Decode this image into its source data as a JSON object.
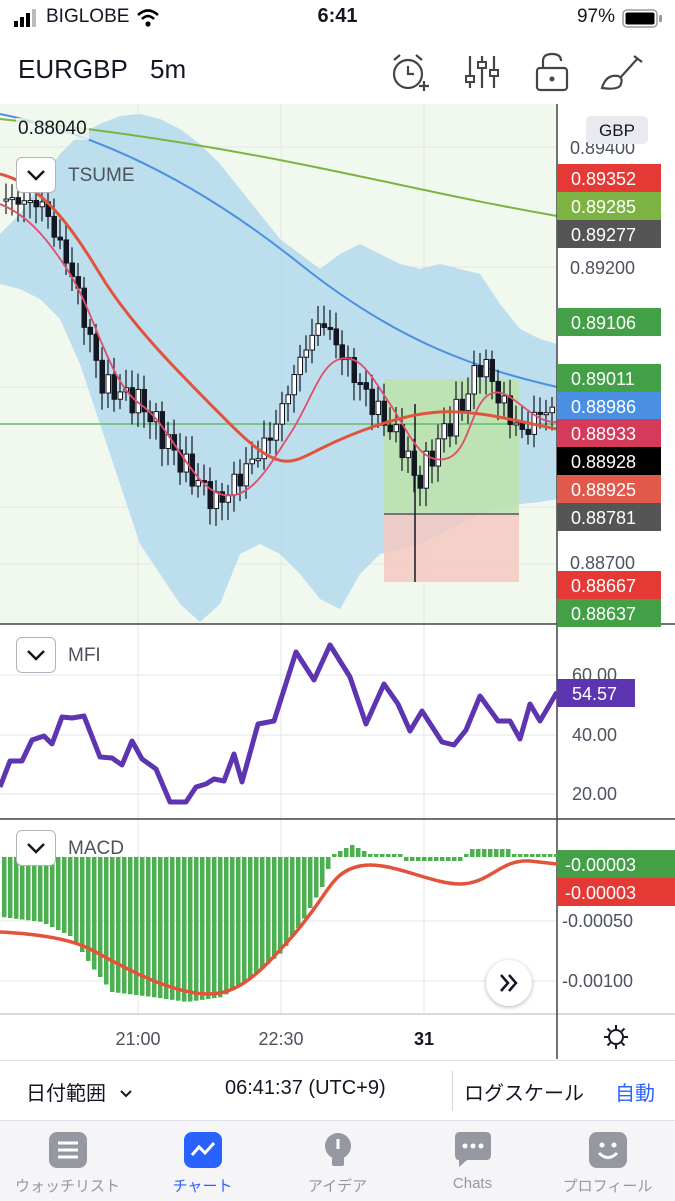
{
  "status_bar": {
    "carrier": "BIGLOBE",
    "time": "6:41",
    "battery": "97%"
  },
  "header": {
    "symbol": "EURGBP",
    "interval": "5m",
    "icons": [
      "alarm-add-icon",
      "indicators-icon",
      "lock-icon",
      "drawing-tools-icon"
    ]
  },
  "chart": {
    "ohlc_readout": "0.88040",
    "currency": "GBP",
    "overlay_label": "TSUME",
    "price_ticks": [
      "0.89400",
      "0.89200",
      "0.88700"
    ],
    "price_tags": [
      {
        "label": "0.89352",
        "color": "#e53935"
      },
      {
        "label": "0.89285",
        "color": "#7cb342"
      },
      {
        "label": "0.89277",
        "color": "#555555"
      },
      {
        "label": "0.89106",
        "color": "#43a047"
      },
      {
        "label": "0.89011",
        "color": "#43a047"
      },
      {
        "label": "0.88986",
        "color": "#4a90e2"
      },
      {
        "label": "0.88933",
        "color": "#d63a5a"
      },
      {
        "label": "0.88928",
        "color": "#000000"
      },
      {
        "label": "0.88925",
        "color": "#e0594a"
      },
      {
        "label": "0.88781",
        "color": "#555555"
      },
      {
        "label": "0.88667",
        "color": "#e53935"
      },
      {
        "label": "0.88637",
        "color": "#43a047"
      }
    ],
    "time_ticks": [
      "21:00",
      "22:30",
      "31"
    ]
  },
  "mfi": {
    "label": "MFI",
    "value": "54.57",
    "ticks": [
      "60.00",
      "40.00",
      "20.00"
    ]
  },
  "macd": {
    "label": "MACD",
    "tags": [
      {
        "label": "-0.00003",
        "color": "#43a047"
      },
      {
        "label": "-0.00003",
        "color": "#e53935"
      }
    ],
    "ticks": [
      "-0.00050",
      "-0.00100"
    ]
  },
  "bottom_bar": {
    "date_range": "日付範囲",
    "clock": "06:41:37 (UTC+9)",
    "log_scale": "ログスケール",
    "auto": "自動"
  },
  "tabs": [
    {
      "label": "ウォッチリスト",
      "icon": "list-icon"
    },
    {
      "label": "チャート",
      "icon": "chart-icon",
      "active": true
    },
    {
      "label": "アイデア",
      "icon": "idea-bulb-icon"
    },
    {
      "label": "Chats",
      "icon": "chat-bubble-icon"
    },
    {
      "label": "プロフィール",
      "icon": "smiley-icon"
    }
  ]
}
